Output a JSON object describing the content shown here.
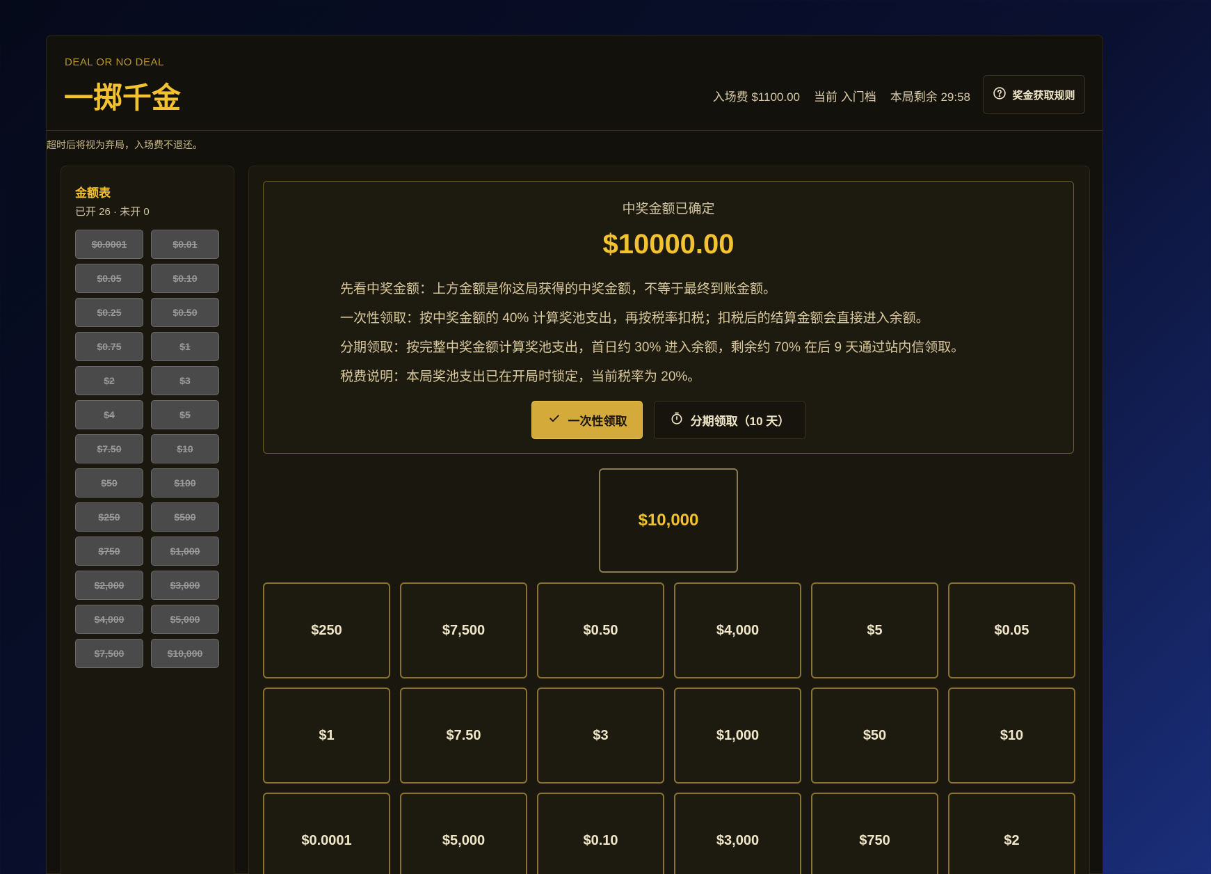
{
  "header": {
    "eyebrow": "DEAL OR NO DEAL",
    "title": "一掷千金",
    "entry_fee": "入场费 $1100.00",
    "tier": "当前 入门档",
    "time_left": "本局剩余 29:58",
    "rules_label": "奖金获取规则"
  },
  "notice": "超时后将视为弃局，入场费不退还。",
  "sidebar": {
    "title": "金额表",
    "subtitle": "已开 26 · 未开 0",
    "amounts": [
      "$0.0001",
      "$0.01",
      "$0.05",
      "$0.10",
      "$0.25",
      "$0.50",
      "$0.75",
      "$1",
      "$2",
      "$3",
      "$4",
      "$5",
      "$7.50",
      "$10",
      "$50",
      "$100",
      "$250",
      "$500",
      "$750",
      "$1,000",
      "$2,000",
      "$3,000",
      "$4,000",
      "$5,000",
      "$7,500",
      "$10,000"
    ]
  },
  "prize": {
    "label": "中奖金额已确定",
    "amount": "$10000.00",
    "notes": [
      "先看中奖金额：上方金额是你这局获得的中奖金额，不等于最终到账金额。",
      "一次性领取：按中奖金额的 40% 计算奖池支出，再按税率扣税；扣税后的结算金额会直接进入余额。",
      "分期领取：按完整中奖金额计算奖池支出，首日约 30% 进入余额，剩余约 70% 在后 9 天通过站内信领取。",
      "税费说明：本局奖池支出已在开局时锁定，当前税率为 20%。"
    ],
    "lump_sum_label": "一次性领取",
    "installment_label": "分期领取（10 天）"
  },
  "final_case": "$10,000",
  "cases": [
    "$250",
    "$7,500",
    "$0.50",
    "$4,000",
    "$5",
    "$0.05",
    "$1",
    "$7.50",
    "$3",
    "$1,000",
    "$50",
    "$10",
    "$0.0001",
    "$5,000",
    "$0.10",
    "$3,000",
    "$750",
    "$2"
  ],
  "colors": {
    "accent": "#f2c230",
    "panel": "#13110b",
    "button": "#d4ab3a"
  }
}
